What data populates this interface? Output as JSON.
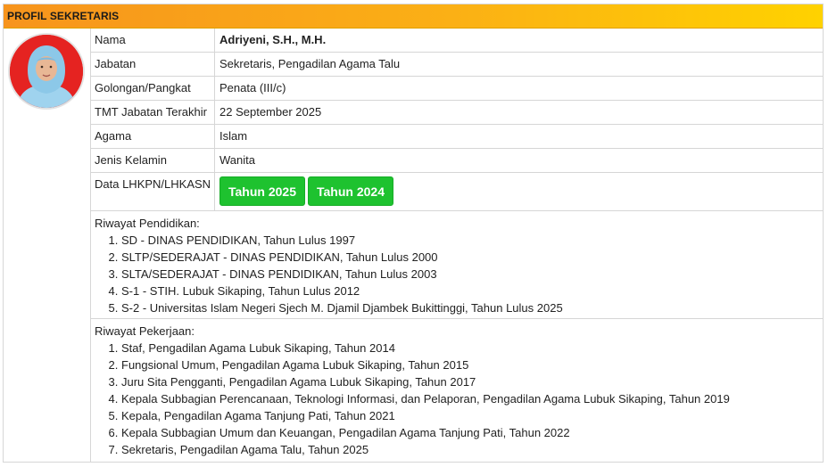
{
  "header": {
    "title": "PROFIL SEKRETARIS"
  },
  "profile": {
    "rows": [
      {
        "label": "Nama",
        "value": "Adriyeni, S.H., M.H."
      },
      {
        "label": "Jabatan",
        "value": "Sekretaris, Pengadilan Agama Talu"
      },
      {
        "label": "Golongan/Pangkat",
        "value": "Penata (III/c)"
      },
      {
        "label": "TMT Jabatan Terakhir",
        "value": "22 September 2025"
      },
      {
        "label": "Agama",
        "value": "Islam"
      },
      {
        "label": "Jenis Kelamin",
        "value": "Wanita"
      }
    ],
    "lhkpn": {
      "label": "Data LHKPN/LHKASN",
      "buttons": [
        "Tahun 2025",
        "Tahun 2024"
      ]
    }
  },
  "education": {
    "title": "Riwayat Pendidikan:",
    "items": [
      "SD - DINAS PENDIDIKAN, Tahun Lulus 1997",
      "SLTP/SEDERAJAT - DINAS PENDIDIKAN, Tahun Lulus 2000",
      "SLTA/SEDERAJAT - DINAS PENDIDIKAN, Tahun Lulus 2003",
      "S-1 - STIH. Lubuk Sikaping, Tahun Lulus 2012",
      "S-2 - Universitas Islam Negeri Sjech M. Djamil Djambek Bukittinggi, Tahun Lulus 2025"
    ]
  },
  "career": {
    "title": "Riwayat Pekerjaan:",
    "items": [
      "Staf, Pengadilan Agama Lubuk Sikaping, Tahun 2014",
      "Fungsional Umum, Pengadilan Agama Lubuk Sikaping, Tahun 2015",
      "Juru Sita Pengganti, Pengadilan Agama Lubuk Sikaping, Tahun 2017",
      "Kepala Subbagian Perencanaan, Teknologi Informasi, dan Pelaporan, Pengadilan Agama Lubuk Sikaping, Tahun 2019",
      "Kepala, Pengadilan Agama Tanjung Pati, Tahun 2021",
      "Kepala Subbagian Umum dan Keuangan, Pengadilan Agama Tanjung Pati, Tahun 2022",
      "Sekretaris, Pengadilan Agama Talu, Tahun 2025"
    ]
  },
  "colors": {
    "header_gradient_start": "#f7941d",
    "header_gradient_end": "#ffd200",
    "button_green": "#1ec22f",
    "photo_background": "#e52321"
  }
}
